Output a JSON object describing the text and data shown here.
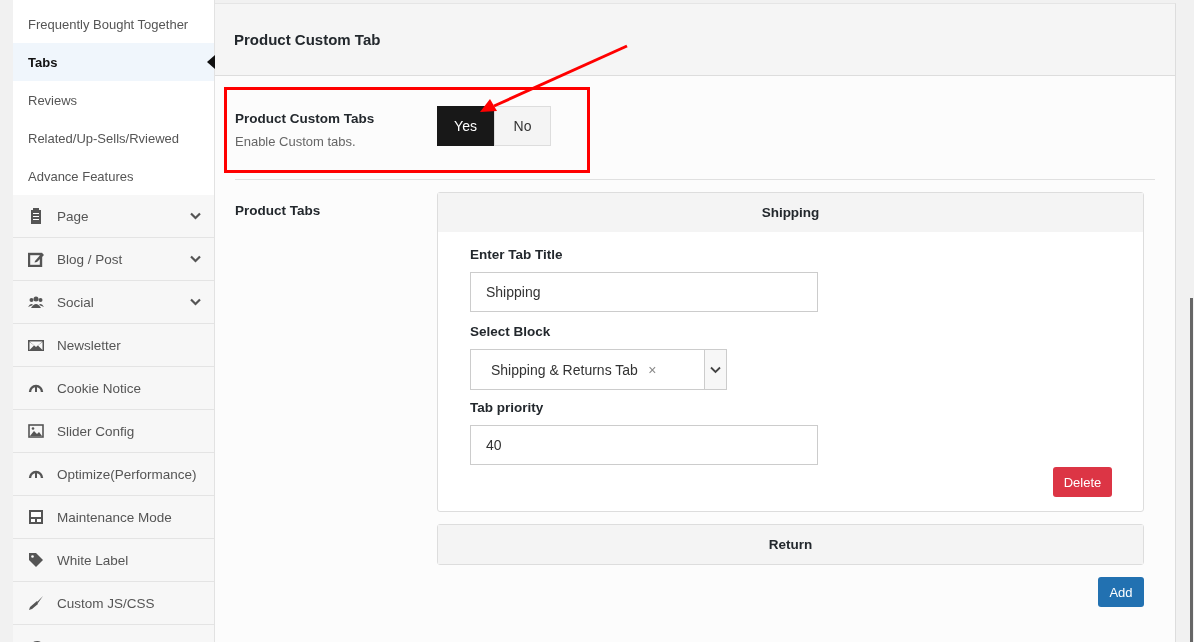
{
  "sidebar": {
    "items": [
      {
        "kind": "sub",
        "label": "Frequently Bought Together",
        "selected": false
      },
      {
        "kind": "sub",
        "label": "Tabs",
        "selected": true
      },
      {
        "kind": "sub",
        "label": "Reviews",
        "selected": false
      },
      {
        "kind": "sub",
        "label": "Related/Up-Sells/Rviewed",
        "selected": false
      },
      {
        "kind": "sub",
        "label": "Advance Features",
        "selected": false
      },
      {
        "kind": "group",
        "label": "Page",
        "expandable": true
      },
      {
        "kind": "group",
        "label": "Blog / Post",
        "expandable": true
      },
      {
        "kind": "group",
        "label": "Social",
        "expandable": true
      },
      {
        "kind": "group",
        "label": "Newsletter",
        "expandable": false
      },
      {
        "kind": "group",
        "label": "Cookie Notice",
        "expandable": false
      },
      {
        "kind": "group",
        "label": "Slider Config",
        "expandable": false
      },
      {
        "kind": "group",
        "label": "Optimize(Performance)",
        "expandable": false
      },
      {
        "kind": "group",
        "label": "Maintenance Mode",
        "expandable": false
      },
      {
        "kind": "group",
        "label": "White Label",
        "expandable": false
      },
      {
        "kind": "group",
        "label": "Custom JS/CSS",
        "expandable": false
      },
      {
        "kind": "group"
      }
    ]
  },
  "section": {
    "title": "Product Custom Tab",
    "custom_tabs": {
      "label": "Product Custom Tabs",
      "description": "Enable Custom tabs.",
      "options": [
        {
          "label": "Yes",
          "selected": true
        },
        {
          "label": "No",
          "selected": false
        }
      ]
    },
    "product_tabs": {
      "label": "Product Tabs",
      "panels": [
        {
          "title": "Shipping",
          "expanded": true,
          "title_label": "Enter Tab Title",
          "title_value": "Shipping",
          "block_label": "Select Block",
          "block_value": "Shipping & Returns Tab",
          "clear": "×",
          "priority_label": "Tab priority",
          "priority_value": "40",
          "delete": "Delete"
        },
        {
          "title": "Return",
          "expanded": false
        }
      ],
      "add": "Add"
    }
  }
}
